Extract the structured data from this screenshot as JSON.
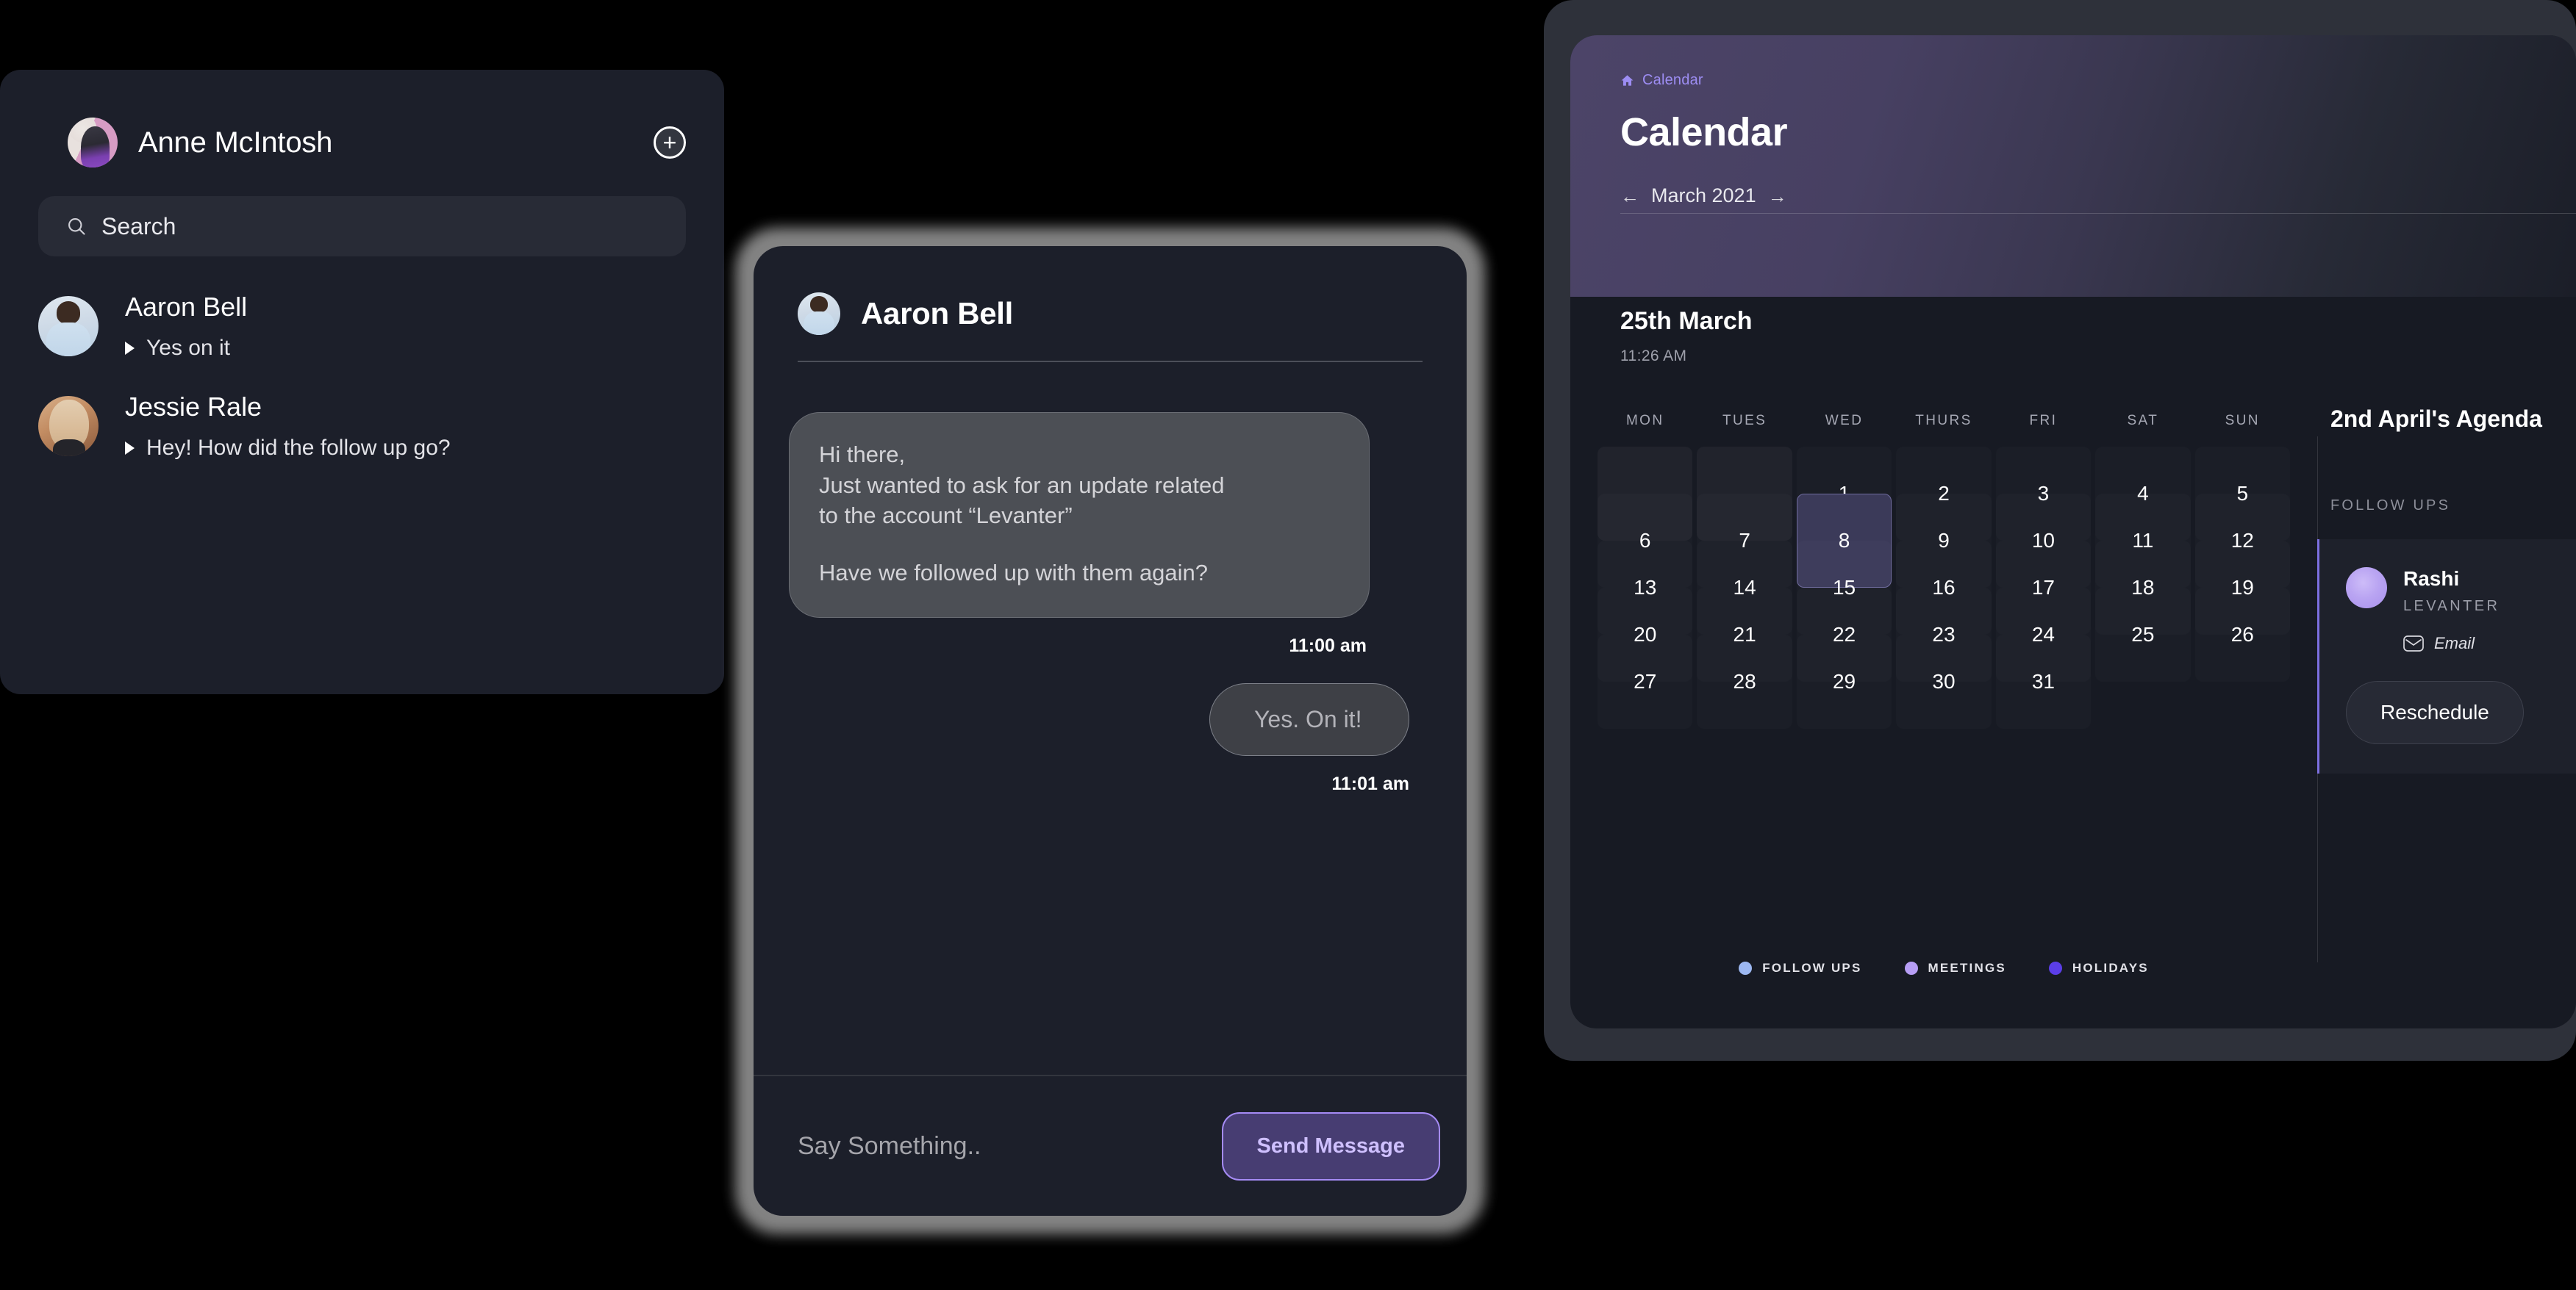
{
  "contacts_panel": {
    "user": {
      "name": "Anne McIntosh",
      "avatar": "anne-avatar"
    },
    "add_button_glyph": "+",
    "search": {
      "placeholder": "Search",
      "value": "",
      "icon": "search-icon"
    },
    "items": [
      {
        "name": "Aaron Bell",
        "preview": "Yes on it",
        "avatar": "aaron-avatar"
      },
      {
        "name": "Jessie Rale",
        "preview": "Hey! How did the follow up go?",
        "avatar": "jessie-avatar"
      }
    ]
  },
  "chat_panel": {
    "title": "Aaron Bell",
    "avatar": "aaron-avatar",
    "messages": [
      {
        "direction": "incoming",
        "paragraphs": [
          "Hi there,\nJust wanted to ask for an update related\nto the account “Levanter”",
          "Have we followed up with them again?"
        ],
        "timestamp": "11:00 am"
      },
      {
        "direction": "outgoing",
        "text": "Yes. On it!",
        "timestamp": "11:01 am"
      }
    ],
    "compose": {
      "placeholder": "Say Something..",
      "value": "",
      "send_label": "Send Message"
    }
  },
  "calendar_panel": {
    "breadcrumb": {
      "icon": "home-icon",
      "label": "Calendar"
    },
    "title": "Calendar",
    "month_nav": {
      "prev_glyph": "←",
      "label": "March 2021",
      "next_glyph": "→"
    },
    "selected_date": "25th March",
    "selected_time": "11:26 AM",
    "day_headers": [
      "MON",
      "TUES",
      "WED",
      "THURS",
      "FRI",
      "SAT",
      "SUN"
    ],
    "leading_blanks": 2,
    "days": [
      1,
      2,
      3,
      4,
      5,
      6,
      7,
      8,
      9,
      10,
      11,
      12,
      13,
      14,
      15,
      16,
      17,
      18,
      19,
      20,
      21,
      22,
      23,
      24,
      25,
      26,
      27,
      28,
      29,
      30,
      31
    ],
    "selected_day": 8,
    "legend": [
      {
        "label": "FOLLOW UPS",
        "color": "#9db8f2"
      },
      {
        "label": "MEETINGS",
        "color": "#b79ef5"
      },
      {
        "label": "HOLIDAYS",
        "color": "#5b3ee8"
      }
    ],
    "agenda": {
      "title": "2nd April's Agenda",
      "section_label": "FOLLOW UPS",
      "person_name": "Rashi",
      "person_org": "LEVANTER",
      "contact_icon": "mail-icon",
      "contact_label": "Email",
      "reschedule_label": "Reschedule"
    }
  },
  "theme": {
    "background": "#000000",
    "panel_bg": "#1c1f2a",
    "calendar_outer_bg": "#2e313a",
    "accent_purple": "#9d8df3",
    "send_btn_bg": "#473d72",
    "send_btn_border": "#a58bf5",
    "selected_day_bg": "#3b3a59"
  }
}
